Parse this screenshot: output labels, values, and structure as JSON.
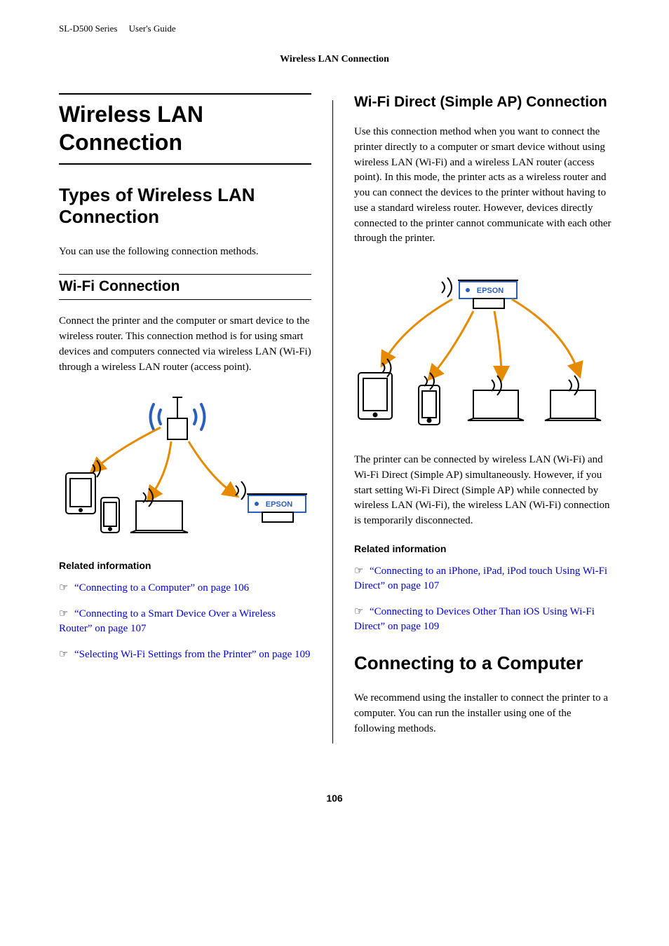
{
  "header": {
    "product": "SL-D500 Series",
    "doc": "User's Guide",
    "section": "Wireless LAN Connection"
  },
  "left": {
    "h1": "Wireless LAN Connection",
    "h2": "Types of Wireless LAN Connection",
    "intro": "You can use the following connection methods.",
    "h3_wifi": "Wi-Fi Connection",
    "wifi_para": "Connect the printer and the computer or smart device to the wireless router. This connection method is for using smart devices and computers connected via wireless LAN (Wi-Fi) through a wireless LAN router (access point).",
    "related_heading": "Related information",
    "links": [
      "“Connecting to a Computer” on page 106",
      "“Connecting to a Smart Device Over a Wireless Router” on page 107",
      "“Selecting Wi-Fi Settings from the Printer” on page 109"
    ]
  },
  "right": {
    "h3_direct": "Wi-Fi Direct (Simple AP) Connection",
    "para1": "Use this connection method when you want to connect the printer directly to a computer or smart device without using wireless LAN (Wi-Fi) and a wireless LAN router (access point). In this mode, the printer acts as a wireless router and you can connect the devices to the printer without having to use a standard wireless router. However, devices directly connected to the printer cannot communicate with each other through the printer.",
    "para2": "The printer can be connected by wireless LAN (Wi-Fi) and Wi-Fi Direct (Simple AP) simultaneously. However, if you start setting Wi-Fi Direct (Simple AP) while connected by wireless LAN (Wi-Fi), the wireless LAN (Wi-Fi) connection is temporarily disconnected.",
    "related_heading": "Related information",
    "links": [
      "“Connecting to an iPhone, iPad, iPod touch Using Wi-Fi Direct” on page 107",
      "“Connecting to Devices Other Than iOS Using Wi-Fi Direct” on page 109"
    ],
    "h2_connecting": "Connecting to a Computer",
    "connecting_para": "We recommend using the installer to connect the printer to a computer. You can run the installer using one of the following methods."
  },
  "diagram_label": "EPSON",
  "page_number": "106"
}
